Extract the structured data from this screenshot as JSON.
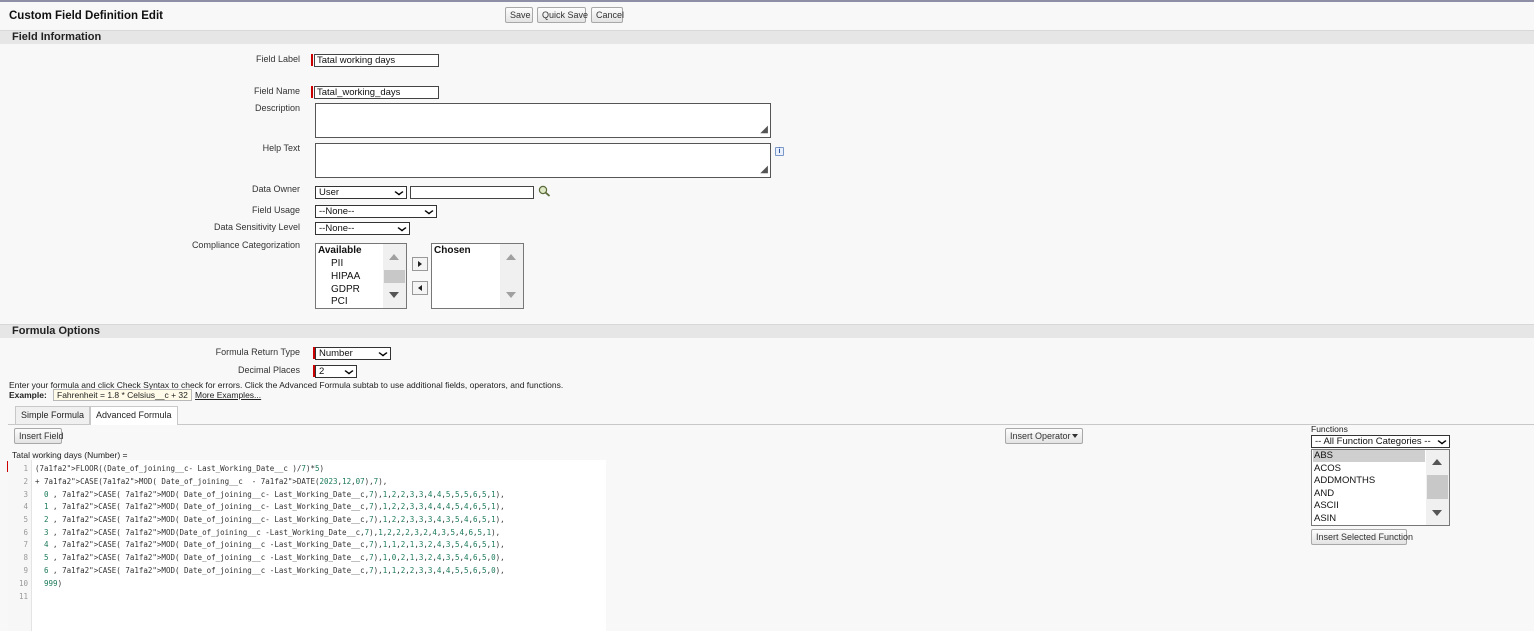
{
  "header": {
    "title": "Custom Field Definition Edit",
    "save_label": "Save",
    "quick_save_label": "Quick Save",
    "cancel_label": "Cancel"
  },
  "field_info": {
    "section_title": "Field Information",
    "field_label_label": "Field Label",
    "field_label_value": "Tatal working days",
    "field_name_label": "Field Name",
    "field_name_value": "Tatal_working_days",
    "description_label": "Description",
    "help_text_label": "Help Text",
    "data_owner_label": "Data Owner",
    "data_owner_value": "User",
    "field_usage_label": "Field Usage",
    "field_usage_value": "--None--",
    "sensitivity_label": "Data Sensitivity Level",
    "sensitivity_value": "--None--",
    "compliance_label": "Compliance Categorization",
    "available_header": "Available",
    "available_options": [
      "PII",
      "HIPAA",
      "GDPR",
      "PCI"
    ],
    "chosen_header": "Chosen"
  },
  "formula_options": {
    "section_title": "Formula Options",
    "return_type_label": "Formula Return Type",
    "return_type_value": "Number",
    "decimal_label": "Decimal Places",
    "decimal_value": "2",
    "instructions": "Enter your formula and click Check Syntax to check for errors. Click the Advanced Formula subtab to use additional fields, operators, and functions.",
    "example_label": "Example:",
    "example_value": "Fahrenheit = 1.8 * Celsius__c + 32",
    "more_examples": "More Examples..."
  },
  "tabs": [
    {
      "label": "Simple Formula",
      "active": false
    },
    {
      "label": "Advanced Formula",
      "active": true
    }
  ],
  "editor": {
    "insert_field_label": "Insert Field",
    "insert_operator_label": "Insert Operator",
    "formula_title": "Tatal working days (Number) =",
    "line_numbers": [
      "1",
      "2",
      "3",
      "4",
      "5",
      "6",
      "7",
      "8",
      "9",
      "10",
      "11"
    ],
    "lines": [
      "(FLOOR((Date_of_joining__c- Last_Working_Date__c )/7)*5)",
      "+ CASE(MOD( Date_of_joining__c  - DATE(2023,12,07),7),",
      "  0 , CASE( MOD( Date_of_joining__c- Last_Working_Date__c,7),1,2,2,3,3,4,4,5,5,5,6,5,1),",
      "  1 , CASE( MOD( Date_of_joining__c- Last_Working_Date__c,7),1,2,2,3,3,4,4,4,5,4,6,5,1),",
      "  2 , CASE( MOD( Date_of_joining__c- Last_Working_Date__c,7),1,2,2,3,3,3,4,3,5,4,6,5,1),",
      "  3 , CASE( MOD(Date_of_joining__c -Last_Working_Date__c,7),1,2,2,2,3,2,4,3,5,4,6,5,1),",
      "  4 , CASE( MOD( Date_of_joining__c -Last_Working_Date__c,7),1,1,2,1,3,2,4,3,5,4,6,5,1),",
      "  5 , CASE( MOD( Date_of_joining__c -Last_Working_Date__c,7),1,0,2,1,3,2,4,3,5,4,6,5,0),",
      "  6 , CASE( MOD( Date_of_joining__c -Last_Working_Date__c,7),1,1,2,2,3,3,4,4,5,5,6,5,0),",
      "  999)",
      ""
    ]
  },
  "functions": {
    "title": "Functions",
    "category_value": "-- All Function Categories --",
    "items": [
      "ABS",
      "ACOS",
      "ADDMONTHS",
      "AND",
      "ASCII",
      "ASIN"
    ],
    "insert_label": "Insert Selected Function"
  },
  "colors": {
    "required": "#cc0000",
    "section_bar": "#e6e6e6",
    "keyword": "#7a1fa2",
    "number": "#1b7a5a",
    "link": "#1a3fbf"
  }
}
